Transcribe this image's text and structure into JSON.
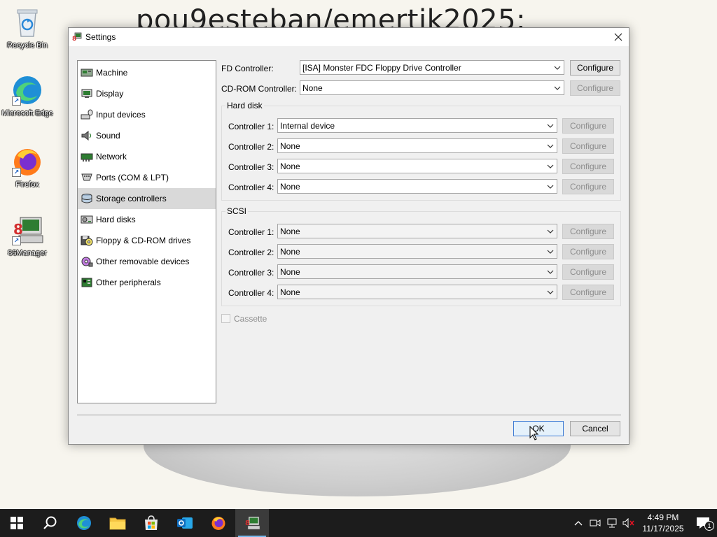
{
  "wallpaper": {
    "text": "pou9esteban/emertik2025:"
  },
  "desktop": {
    "icons": [
      {
        "name": "recycle-bin",
        "label": "Recycle Bin"
      },
      {
        "name": "microsoft-edge",
        "label": "Microsoft Edge"
      },
      {
        "name": "firefox",
        "label": "Firefox"
      },
      {
        "name": "86manager",
        "label": "86Manager"
      }
    ]
  },
  "window": {
    "title": "Settings",
    "sidebar": {
      "items": [
        {
          "label": "Machine",
          "icon": "machine-icon"
        },
        {
          "label": "Display",
          "icon": "display-icon"
        },
        {
          "label": "Input devices",
          "icon": "input-devices-icon"
        },
        {
          "label": "Sound",
          "icon": "sound-icon"
        },
        {
          "label": "Network",
          "icon": "network-icon"
        },
        {
          "label": "Ports (COM & LPT)",
          "icon": "ports-icon"
        },
        {
          "label": "Storage controllers",
          "icon": "storage-controllers-icon",
          "selected": true
        },
        {
          "label": "Hard disks",
          "icon": "hard-disks-icon"
        },
        {
          "label": "Floppy & CD-ROM drives",
          "icon": "floppy-cdrom-icon"
        },
        {
          "label": "Other removable devices",
          "icon": "removable-devices-icon"
        },
        {
          "label": "Other peripherals",
          "icon": "peripherals-icon"
        }
      ]
    },
    "fd": {
      "label": "FD Controller:",
      "value": "[ISA] Monster FDC Floppy Drive Controller",
      "configure": "Configure"
    },
    "cdrom": {
      "label": "CD-ROM Controller:",
      "value": "None",
      "configure": "Configure"
    },
    "hard_disk": {
      "title": "Hard disk",
      "controllers": [
        {
          "label": "Controller 1:",
          "value": "Internal device",
          "configure": "Configure"
        },
        {
          "label": "Controller 2:",
          "value": "None",
          "configure": "Configure"
        },
        {
          "label": "Controller 3:",
          "value": "None",
          "configure": "Configure"
        },
        {
          "label": "Controller 4:",
          "value": "None",
          "configure": "Configure"
        }
      ]
    },
    "scsi": {
      "title": "SCSI",
      "controllers": [
        {
          "label": "Controller 1:",
          "value": "None",
          "configure": "Configure"
        },
        {
          "label": "Controller 2:",
          "value": "None",
          "configure": "Configure"
        },
        {
          "label": "Controller 3:",
          "value": "None",
          "configure": "Configure"
        },
        {
          "label": "Controller 4:",
          "value": "None",
          "configure": "Configure"
        }
      ]
    },
    "cassette": {
      "label": "Cassette",
      "checked": false
    },
    "ok_label": "OK",
    "cancel_label": "Cancel"
  },
  "taskbar": {
    "clock_time": "4:49 PM",
    "clock_date": "11/17/2025",
    "notification_count": "1",
    "accent": "#76b9ed"
  }
}
